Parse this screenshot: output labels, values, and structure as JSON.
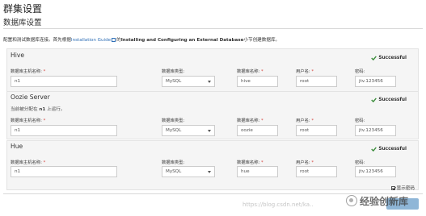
{
  "page": {
    "title": "群集设置",
    "section": "数据库设置",
    "intro_before": "配置和测试数据库连接。首先根据",
    "intro_link": "Installation Guide",
    "intro_mid": "的",
    "intro_bold": "Installing and Configuring an External Database",
    "intro_after": "小节创建数据库。"
  },
  "labels": {
    "host": "数据库主机名称:",
    "type": "数据库类型:",
    "dbname": "数据库名称:",
    "user": "用户名:",
    "password": "密码:",
    "required": "*"
  },
  "services": [
    {
      "name": "Hive",
      "status": "Successful",
      "host": "n1",
      "type": "MySQL",
      "dbname": "hive",
      "user": "root",
      "password": "jtv.123456"
    },
    {
      "name": "Oozie Server",
      "note_before": "当前被分配在",
      "note_host": "n1",
      "note_after": "上运行。",
      "status": "Successful",
      "host": "n1",
      "type": "MySQL",
      "dbname": "oozie",
      "user": "root",
      "password": "jtv.123456"
    },
    {
      "name": "Hue",
      "status": "Successful",
      "host": "n1",
      "type": "MySQL",
      "dbname": "hue",
      "user": "root",
      "password": "jtv.123456"
    }
  ],
  "show_password": "显示密码",
  "watermark": {
    "url": "https://blog.csdn.net/ka..",
    "logo_text": "经验创新库"
  },
  "colors": {
    "link": "#2f6fb6",
    "success": "#3c8d3c",
    "required": "#d43f3a"
  },
  "icons": {
    "status": "check-icon",
    "link": "external-link-icon",
    "select": "chevron-down-icon"
  }
}
